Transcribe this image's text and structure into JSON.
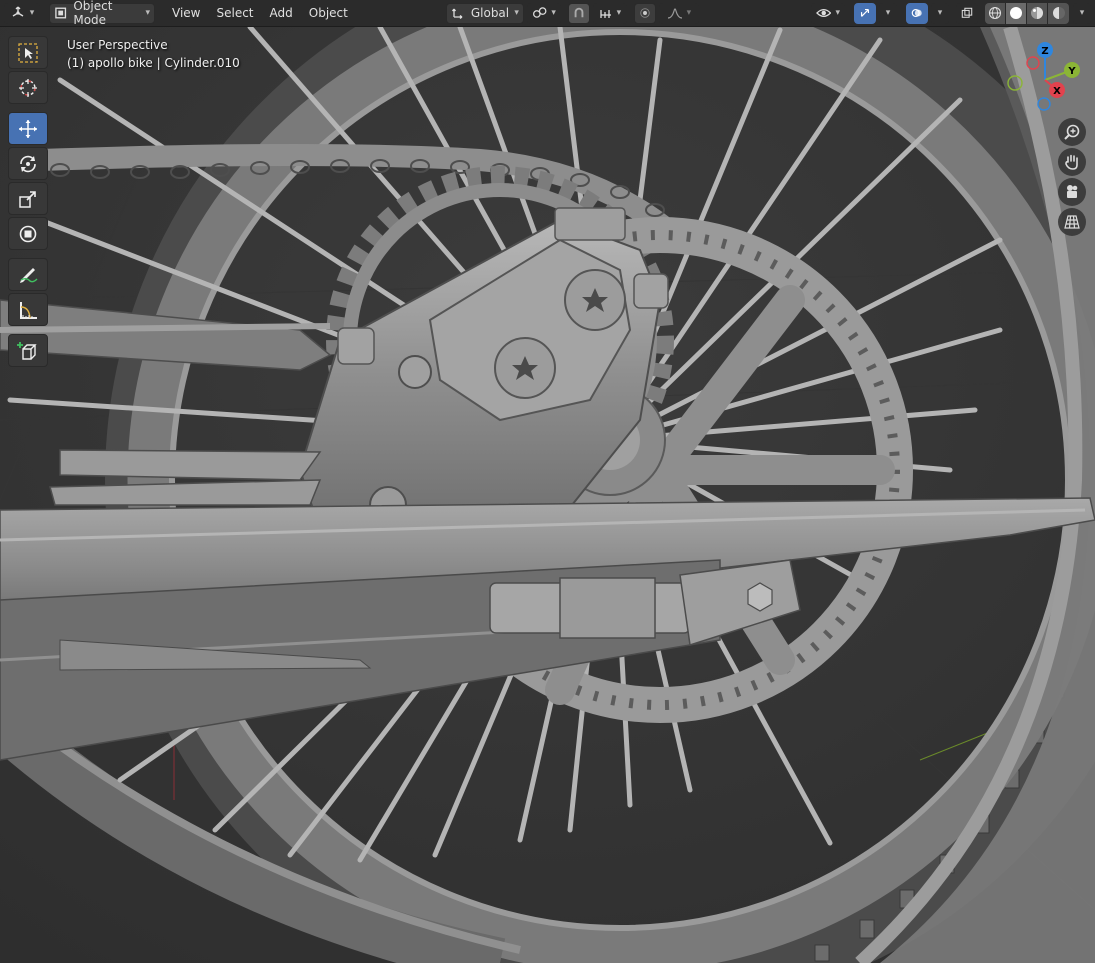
{
  "header": {
    "editor_type_icon": "3d-viewport-icon",
    "mode_label": "Object Mode",
    "menus": [
      "View",
      "Select",
      "Add",
      "Object"
    ],
    "transform_orientation": "Global",
    "icons": {
      "pivot": "pivot-point-icon",
      "snap": "snap-icon",
      "snap_increment": "snap-increment-icon",
      "proportional": "proportional-edit-icon",
      "falloff": "falloff-curve-icon",
      "visibility": "eye-visibility-icon",
      "gizmos": "gizmo-icon",
      "overlays": "overlay-icon",
      "xray": "xray-icon",
      "shading_wire": "wireframe-shading-icon",
      "shading_solid": "solid-shading-icon",
      "shading_material": "material-preview-icon",
      "shading_rendered": "rendered-shading-icon"
    }
  },
  "viewport": {
    "perspective_label": "User Perspective",
    "object_label": "(1) apollo bike | Cylinder.010",
    "gizmo_axes": {
      "x": "X",
      "y": "Y",
      "z": "Z"
    },
    "colors": {
      "x": "#e2424d",
      "y": "#8bb536",
      "z": "#2f86de",
      "accent": "#4772b3"
    }
  },
  "toolbar": {
    "tools": [
      {
        "name": "select-box-tool",
        "icon": "select-box-icon",
        "active": false
      },
      {
        "name": "cursor-tool",
        "icon": "cursor-icon",
        "active": false
      },
      {
        "name": "move-tool",
        "icon": "move-icon",
        "active": true
      },
      {
        "name": "rotate-tool",
        "icon": "rotate-icon",
        "active": false
      },
      {
        "name": "scale-tool",
        "icon": "scale-icon",
        "active": false
      },
      {
        "name": "transform-tool",
        "icon": "transform-icon",
        "active": false
      },
      {
        "name": "annotate-tool",
        "icon": "annotate-icon",
        "active": false
      },
      {
        "name": "measure-tool",
        "icon": "measure-icon",
        "active": false
      },
      {
        "name": "add-cube-tool",
        "icon": "add-cube-icon",
        "active": false
      }
    ]
  },
  "navigation": [
    "zoom-icon",
    "pan-hand-icon",
    "camera-icon",
    "orthographic-grid-icon"
  ]
}
